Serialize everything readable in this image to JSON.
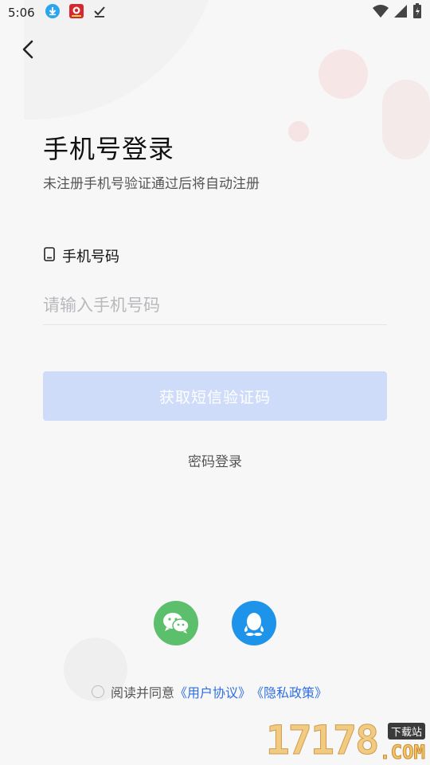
{
  "status_bar": {
    "time": "5:06",
    "left_icons": [
      "download-icon",
      "app-notification-icon",
      "check-icon"
    ],
    "right_icons": [
      "wifi-icon",
      "signal-icon",
      "battery-icon"
    ]
  },
  "nav": {
    "back_icon": "chevron-left-icon"
  },
  "header": {
    "title": "手机号登录",
    "subtitle": "未注册手机号验证通过后将自动注册"
  },
  "phone_field": {
    "label": "手机号码",
    "placeholder": "请输入手机号码",
    "value": ""
  },
  "sms_button": {
    "label": "获取短信验证码",
    "color": "#cfdcf9"
  },
  "password_login": {
    "label": "密码登录"
  },
  "social_login": [
    {
      "name": "wechat",
      "icon": "wechat-icon",
      "color": "#5cbf6c"
    },
    {
      "name": "qq",
      "icon": "qq-icon",
      "color": "#1d94ea"
    }
  ],
  "agreement": {
    "prefix": "阅读并同意",
    "user_agreement": "《用户协议》",
    "privacy_policy": "《隐私政策》",
    "checked": false
  },
  "watermark": {
    "number": "17178",
    "tag": "下载站",
    "suffix": ".COM"
  },
  "colors": {
    "accent": "#2f6fe0",
    "background": "#f7f7f8"
  }
}
